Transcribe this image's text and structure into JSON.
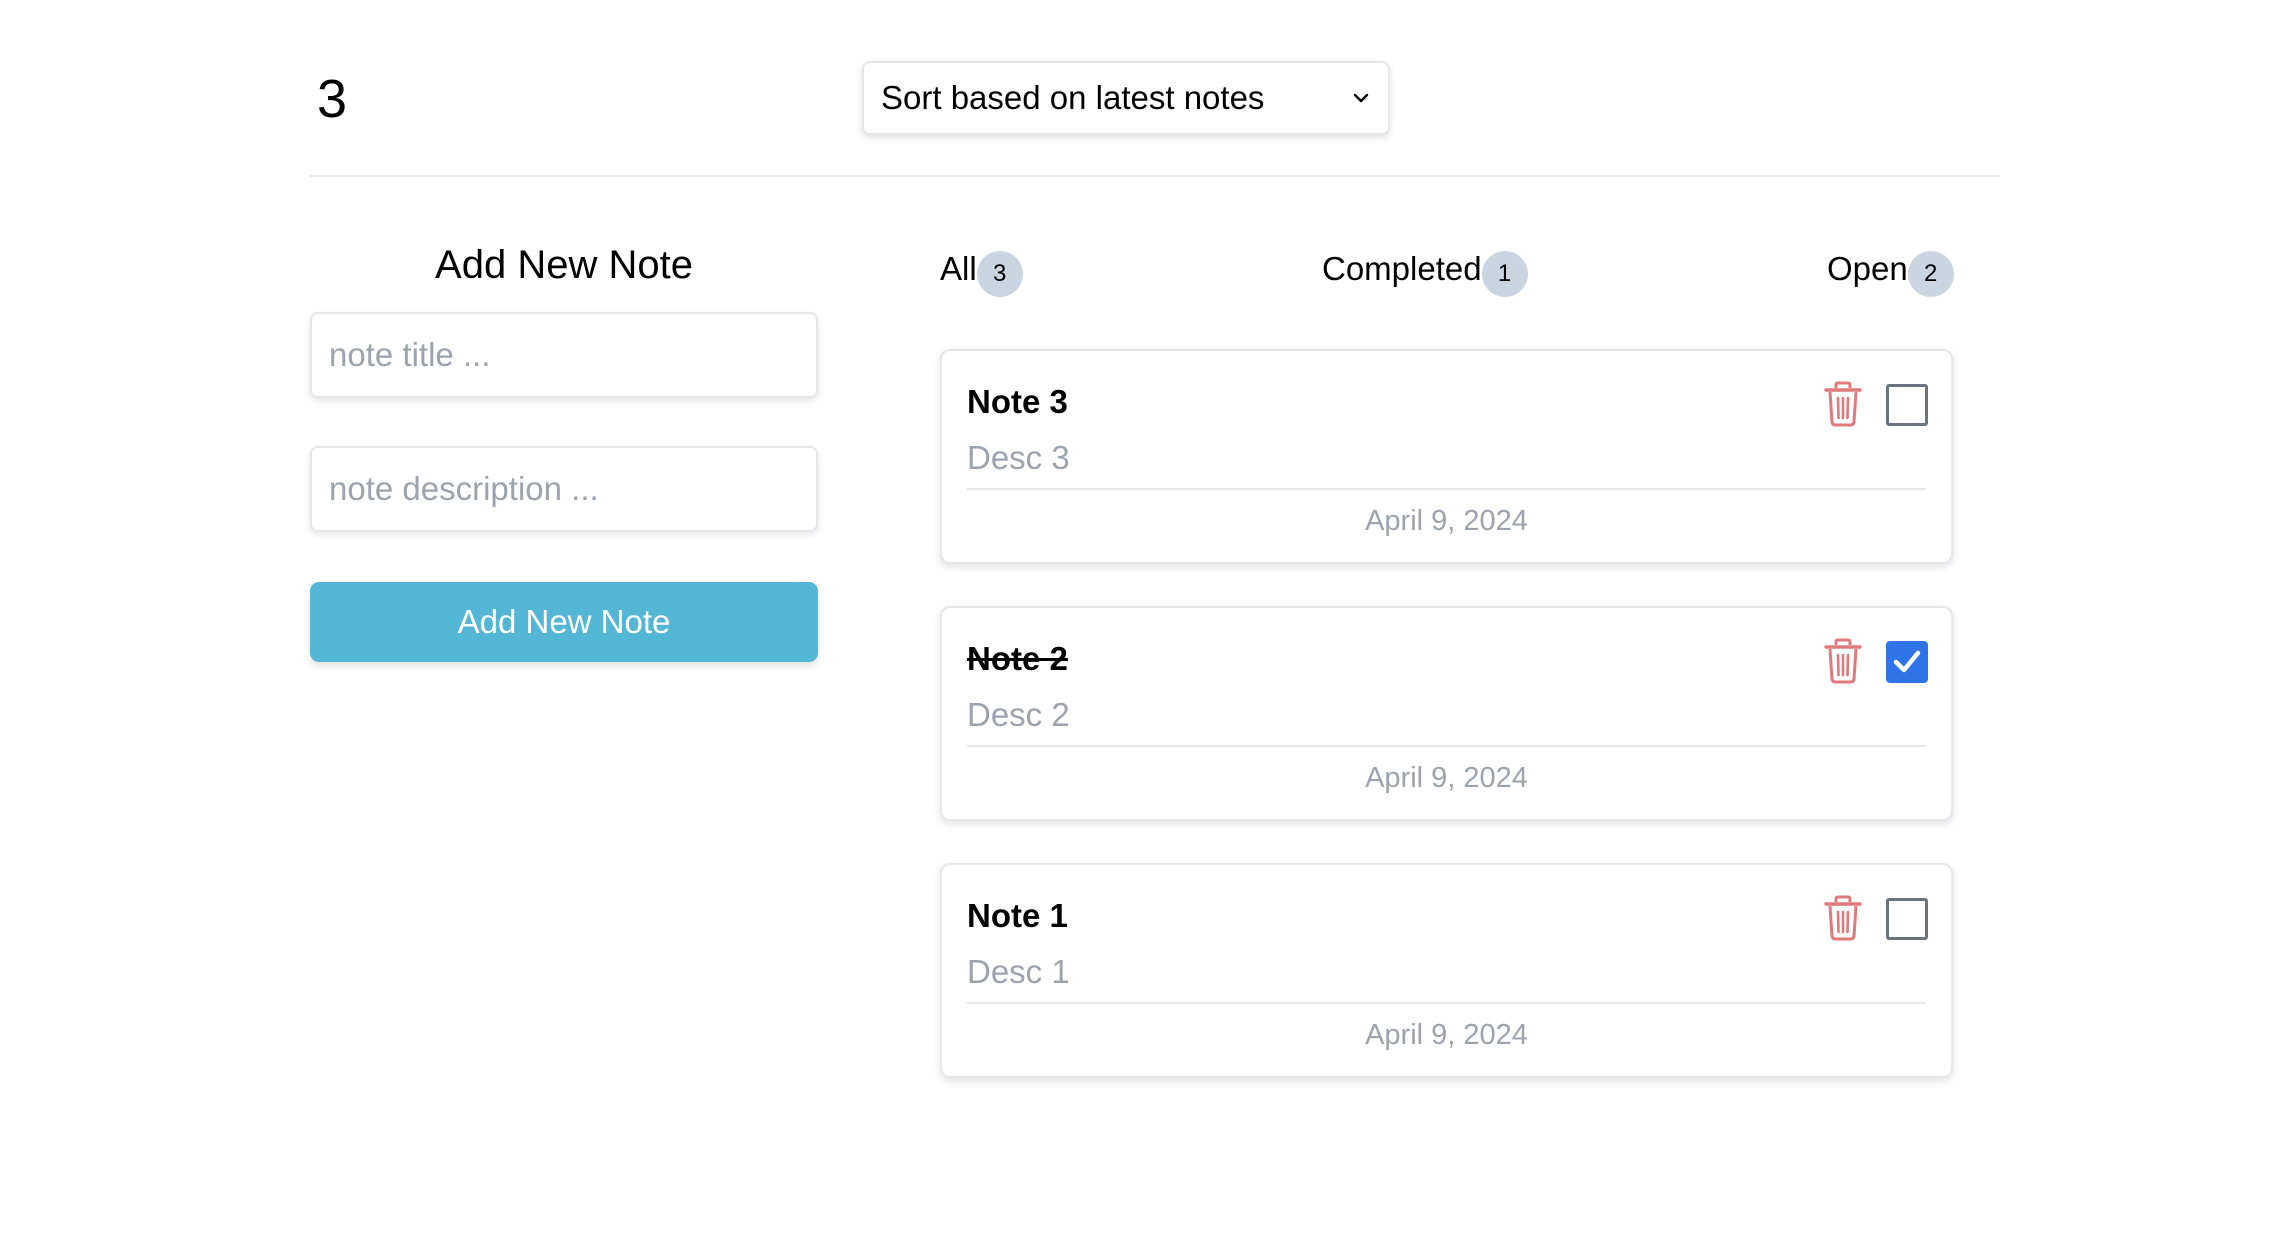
{
  "header": {
    "count": "3",
    "sort": {
      "selected": "Sort based on latest notes"
    }
  },
  "form": {
    "title": "Add New Note",
    "title_placeholder": "note title ...",
    "desc_placeholder": "note description ...",
    "submit_label": "Add New Note"
  },
  "filters": [
    {
      "label": "All",
      "count": "3"
    },
    {
      "label": "Completed",
      "count": "1"
    },
    {
      "label": "Open",
      "count": "2"
    }
  ],
  "notes": [
    {
      "title": "Note 3",
      "desc": "Desc 3",
      "date": "April 9, 2024",
      "completed": false
    },
    {
      "title": "Note 2",
      "desc": "Desc 2",
      "date": "April 9, 2024",
      "completed": true
    },
    {
      "title": "Note 1",
      "desc": "Desc 1",
      "date": "April 9, 2024",
      "completed": false
    }
  ],
  "colors": {
    "accent": "#53b6d4",
    "trash": "#e07a7a",
    "checked": "#2f73e8",
    "badge": "#cbd5e1"
  },
  "icons": {
    "delete": "trash-icon",
    "sort_chevron": "chevron-down-icon",
    "check": "check-icon"
  }
}
